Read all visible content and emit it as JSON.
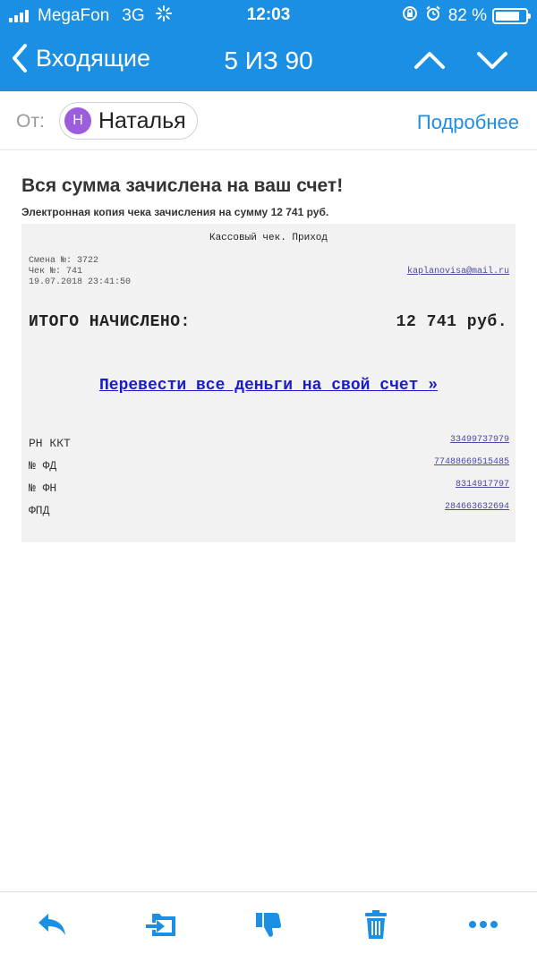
{
  "status_bar": {
    "carrier": "MegaFon",
    "network": "3G",
    "time": "12:03",
    "battery": "82 %",
    "battery_level": 0.82
  },
  "nav": {
    "back_label": "Входящие",
    "counter": "5 ИЗ 90"
  },
  "sender": {
    "from_label": "От:",
    "initial": "Н",
    "name": "Наталья",
    "avatar_color": "#9b5ddb",
    "details_link": "Подробнее"
  },
  "message": {
    "subject": "Вся сумма зачислена на ваш счет!",
    "preheader": "Электронная копия чека зачисления на сумму 12 741 руб."
  },
  "receipt": {
    "title": "Кассовый чек. Приход",
    "shift": "Смена №: 3722",
    "check": "Чек №: 741",
    "datetime": "19.07.2018 23:41:50",
    "email": "kaplanovisa@mail.ru",
    "total_label": "ИТОГО НАЧИСЛЕНО:",
    "total_value": "12 741 руб.",
    "transfer_link": "Перевести все деньги на свой счет »",
    "rows": [
      {
        "label": "РН ККТ",
        "value": "33499737979"
      },
      {
        "label": "№ ФД",
        "value": "77488669515485"
      },
      {
        "label": "№ ФН",
        "value": "8314917797"
      },
      {
        "label": "ФПД",
        "value": "284663632694"
      }
    ]
  },
  "toolbar": {
    "icons": [
      "reply-icon",
      "move-to-folder-icon",
      "thumbs-down-icon",
      "trash-icon",
      "more-icon"
    ]
  },
  "colors": {
    "accent": "#1a8fe3",
    "receipt_bg": "#f2f2f2",
    "link": "#1a1ad0"
  }
}
